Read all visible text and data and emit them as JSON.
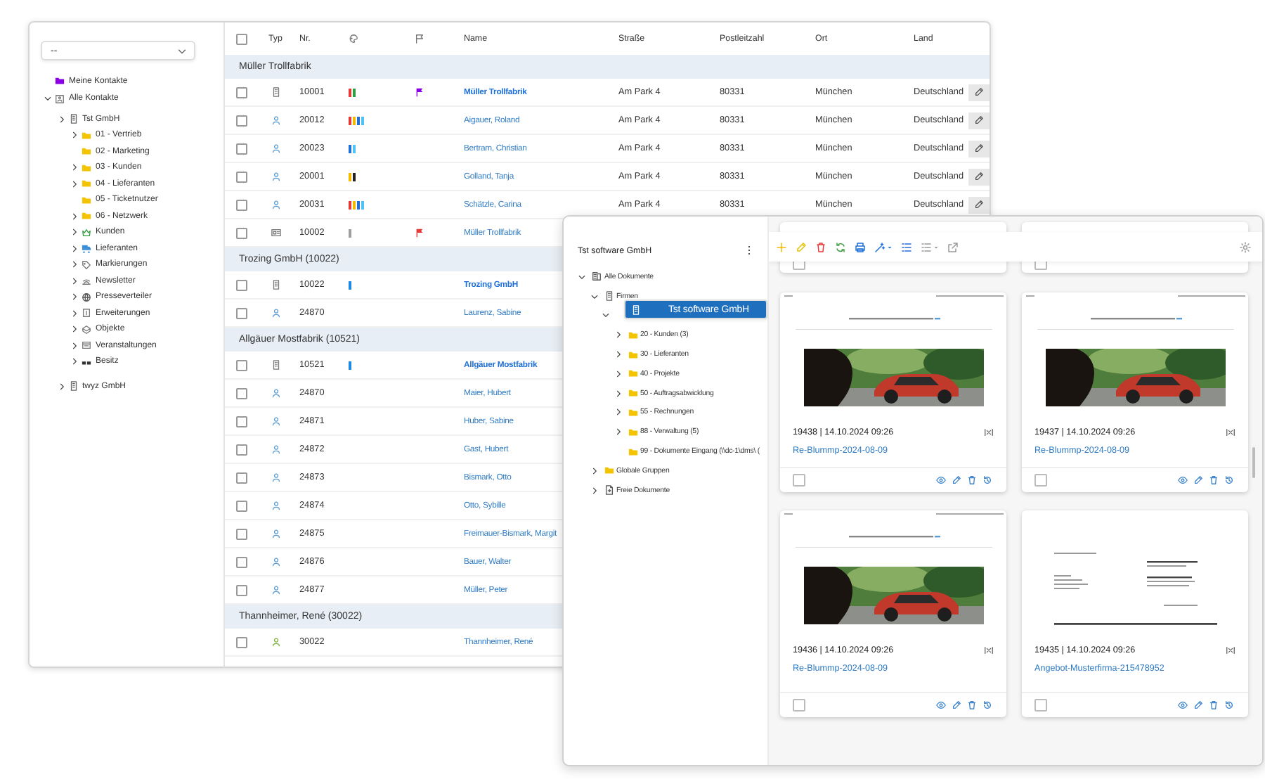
{
  "sidebar": {
    "select": {
      "value": "--"
    },
    "tree": [
      {
        "label": "Meine Kontakte",
        "kind": "folder-purple"
      },
      {
        "label": "Alle Kontakte",
        "kind": "contacts",
        "expanded": true,
        "children": [
          {
            "label": "Tst GmbH",
            "kind": "building",
            "expanded": false,
            "children": [
              {
                "label": "01 - Vertrieb",
                "kind": "folder",
                "expanded": false
              },
              {
                "label": "02 - Marketing",
                "kind": "folder"
              },
              {
                "label": "03 - Kunden",
                "kind": "folder",
                "expanded": false
              },
              {
                "label": "04 - Lieferanten",
                "kind": "folder",
                "expanded": false
              },
              {
                "label": "05 - Ticketnutzer",
                "kind": "folder"
              },
              {
                "label": "06 - Netzwerk",
                "kind": "folder",
                "expanded": false
              },
              {
                "label": "Kunden",
                "kind": "crown",
                "expanded": false
              },
              {
                "label": "Lieferanten",
                "kind": "truck",
                "expanded": false
              },
              {
                "label": "Markierungen",
                "kind": "tag",
                "expanded": false
              },
              {
                "label": "Newsletter",
                "kind": "newsletter",
                "expanded": false
              },
              {
                "label": "Presseverteiler",
                "kind": "globe",
                "expanded": false
              },
              {
                "label": "Erweiterungen",
                "kind": "extension",
                "expanded": false
              },
              {
                "label": "Objekte",
                "kind": "object",
                "expanded": false
              },
              {
                "label": "Veranstaltungen",
                "kind": "event",
                "expanded": false
              },
              {
                "label": "Besitz",
                "kind": "glasses",
                "expanded": false
              }
            ]
          },
          {
            "label": "twyz GmbH",
            "kind": "building",
            "expanded": false
          }
        ]
      }
    ]
  },
  "table": {
    "header_checkbox": {
      "checked": false
    },
    "columns": [
      "Typ",
      "Nr.",
      "Name",
      "Straße",
      "Postleitzahl",
      "Ort",
      "Land"
    ],
    "groups": [
      {
        "title": "Müller Trollfabrik",
        "rows": [
          {
            "checked": false,
            "typ": {
              "kind": "company",
              "color": "#777777"
            },
            "nr": "10001",
            "tags": [
              {
                "color": "#e53935"
              },
              {
                "color": "#2e9e3e"
              }
            ],
            "flag": {
              "color": "#8a00e6"
            },
            "name": "Müller Trollfabrik",
            "bold": true,
            "street": "Am Park 4",
            "zip": "80331",
            "city": "München",
            "country": "Deutschland",
            "editable": true
          },
          {
            "checked": false,
            "typ": {
              "kind": "person",
              "color": "#5b9bd5"
            },
            "nr": "20012",
            "tags": [
              {
                "color": "#e53935"
              },
              {
                "color": "#f5b800"
              },
              {
                "color": "#1e6fd9"
              },
              {
                "color": "#4fc3f7"
              }
            ],
            "name": "Aigauer, Roland",
            "bold": false,
            "street": "Am Park 4",
            "zip": "80331",
            "city": "München",
            "country": "Deutschland",
            "editable": true
          },
          {
            "checked": false,
            "typ": {
              "kind": "person",
              "color": "#5b9bd5"
            },
            "nr": "20023",
            "tags": [
              {
                "color": "#1e6fd9"
              },
              {
                "color": "#4fc3f7"
              }
            ],
            "name": "Bertram, Christian",
            "bold": false,
            "street": "Am Park 4",
            "zip": "80331",
            "city": "München",
            "country": "Deutschland",
            "editable": true
          },
          {
            "checked": false,
            "typ": {
              "kind": "person",
              "color": "#5b9bd5"
            },
            "nr": "20001",
            "tags": [
              {
                "color": "#f5b800"
              },
              {
                "color": "#222222"
              }
            ],
            "name": "Golland, Tanja",
            "bold": false,
            "street": "Am Park 4",
            "zip": "80331",
            "city": "München",
            "country": "Deutschland",
            "editable": true
          },
          {
            "checked": false,
            "typ": {
              "kind": "person",
              "color": "#5b9bd5"
            },
            "nr": "20031",
            "tags": [
              {
                "color": "#e53935"
              },
              {
                "color": "#f5b800"
              },
              {
                "color": "#1e6fd9"
              },
              {
                "color": "#4fc3f7"
              }
            ],
            "name": "Schätzle, Carina",
            "bold": false,
            "street": "Am Park 4",
            "zip": "80331",
            "city": "München",
            "country": "Deutschland",
            "editable": true
          },
          {
            "checked": false,
            "typ": {
              "kind": "card",
              "color": "#777777"
            },
            "nr": "10002",
            "tags": [
              {
                "color": "#9e9e9e"
              }
            ],
            "flag": {
              "color": "#e53935"
            },
            "name": "Müller Trollfabrik",
            "bold": false
          }
        ]
      },
      {
        "title": "Trozing GmbH (10022)",
        "rows": [
          {
            "checked": false,
            "typ": {
              "kind": "company",
              "color": "#777777"
            },
            "nr": "10022",
            "tags": [
              {
                "color": "#1e88e5"
              }
            ],
            "name": "Trozing GmbH",
            "bold": true
          },
          {
            "checked": false,
            "typ": {
              "kind": "person",
              "color": "#5b9bd5"
            },
            "nr": "24870",
            "name": "Laurenz, Sabine",
            "bold": false
          }
        ]
      },
      {
        "title": "Allgäuer Mostfabrik (10521)",
        "rows": [
          {
            "checked": false,
            "typ": {
              "kind": "company",
              "color": "#777777"
            },
            "nr": "10521",
            "tags": [
              {
                "color": "#1e88e5"
              }
            ],
            "name": "Allgäuer Mostfabrik",
            "bold": true
          },
          {
            "checked": false,
            "typ": {
              "kind": "person",
              "color": "#5b9bd5"
            },
            "nr": "24870",
            "name": "Maier, Hubert",
            "bold": false
          },
          {
            "checked": false,
            "typ": {
              "kind": "person",
              "color": "#5b9bd5"
            },
            "nr": "24871",
            "name": "Huber, Sabine",
            "bold": false
          },
          {
            "checked": false,
            "typ": {
              "kind": "person",
              "color": "#5b9bd5"
            },
            "nr": "24872",
            "name": "Gast, Hubert",
            "bold": false
          },
          {
            "checked": false,
            "typ": {
              "kind": "person",
              "color": "#5b9bd5"
            },
            "nr": "24873",
            "name": "Bismark, Otto",
            "bold": false
          },
          {
            "checked": false,
            "typ": {
              "kind": "person",
              "color": "#5b9bd5"
            },
            "nr": "24874",
            "name": "Otto, Sybille",
            "bold": false
          },
          {
            "checked": false,
            "typ": {
              "kind": "person",
              "color": "#5b9bd5"
            },
            "nr": "24875",
            "name": "Freimauer-Bismark, Margit",
            "bold": false
          },
          {
            "checked": false,
            "typ": {
              "kind": "person",
              "color": "#5b9bd5"
            },
            "nr": "24876",
            "name": "Bauer, Walter",
            "bold": false
          },
          {
            "checked": false,
            "typ": {
              "kind": "person",
              "color": "#5b9bd5"
            },
            "nr": "24877",
            "name": "Müller, Peter",
            "bold": false
          }
        ]
      },
      {
        "title": "Thannheimer, René (30022)",
        "rows": [
          {
            "checked": false,
            "typ": {
              "kind": "person",
              "color": "#7cb342"
            },
            "nr": "30022",
            "name": "Thannheimer, René",
            "bold": false
          }
        ]
      }
    ]
  },
  "doc_window": {
    "title": "Tst software GmbH",
    "toolbar": [
      {
        "kind": "add",
        "caret": false
      },
      {
        "kind": "edit",
        "caret": false
      },
      {
        "kind": "delete",
        "caret": false
      },
      {
        "kind": "refresh",
        "caret": false
      },
      {
        "kind": "print",
        "caret": false
      },
      {
        "kind": "wand",
        "caret": true
      },
      {
        "kind": "list",
        "caret": false
      },
      {
        "kind": "list-menu",
        "caret": true
      },
      {
        "kind": "external",
        "caret": false
      }
    ],
    "tree": [
      {
        "label": "Alle Dokumente",
        "kind": "documents",
        "expanded": true,
        "selected": false,
        "children": [
          {
            "label": "Firmen",
            "kind": "building",
            "expanded": true,
            "selected": false,
            "children": [
              {
                "label": "Tst software GmbH",
                "kind": "building",
                "expanded": true,
                "selected": true,
                "children": [
                  {
                    "label": "20 - Kunden (3)",
                    "kind": "folder",
                    "expanded": false,
                    "selected": false
                  },
                  {
                    "label": "30 - Lieferanten",
                    "kind": "folder",
                    "expanded": false,
                    "selected": false
                  },
                  {
                    "label": "40 - Projekte",
                    "kind": "folder",
                    "expanded": false,
                    "selected": false
                  },
                  {
                    "label": "50 - Auftragsabwicklung",
                    "kind": "folder",
                    "expanded": false,
                    "selected": false
                  },
                  {
                    "label": "55 - Rechnungen",
                    "kind": "folder",
                    "expanded": false,
                    "selected": false
                  },
                  {
                    "label": "88 - Verwaltung (5)",
                    "kind": "folder",
                    "expanded": false,
                    "selected": false
                  },
                  {
                    "label": "99 - Dokumente Eingang (\\\\dc-1\\dms\\ (",
                    "kind": "folder",
                    "selected": false
                  }
                ]
              }
            ]
          },
          {
            "label": "Globale Gruppen",
            "kind": "folder",
            "expanded": false,
            "selected": false
          },
          {
            "label": "Freie Dokumente",
            "kind": "free-doc",
            "expanded": false,
            "selected": false
          }
        ]
      }
    ],
    "cards": [
      {
        "kind": "partial",
        "checked": false
      },
      {
        "kind": "partial",
        "checked": false
      },
      {
        "kind": "full",
        "preview": {
          "kind": "email"
        },
        "meta": "19438 | 14.10.2024 09:26",
        "link": "Re-Blummp-2024-08-09",
        "checked": false
      },
      {
        "kind": "full",
        "preview": {
          "kind": "email"
        },
        "meta": "19437 | 14.10.2024 09:26",
        "link": "Re-Blummp-2024-08-09",
        "checked": false
      },
      {
        "kind": "full",
        "preview": {
          "kind": "email"
        },
        "meta": "19436 | 14.10.2024 09:26",
        "link": "Re-Blummp-2024-08-09",
        "checked": false
      },
      {
        "kind": "full",
        "preview": {
          "kind": "letter"
        },
        "meta": "19435 | 14.10.2024 09:26",
        "link": "Angebot-Musterfirma-215478952",
        "checked": false
      }
    ]
  }
}
